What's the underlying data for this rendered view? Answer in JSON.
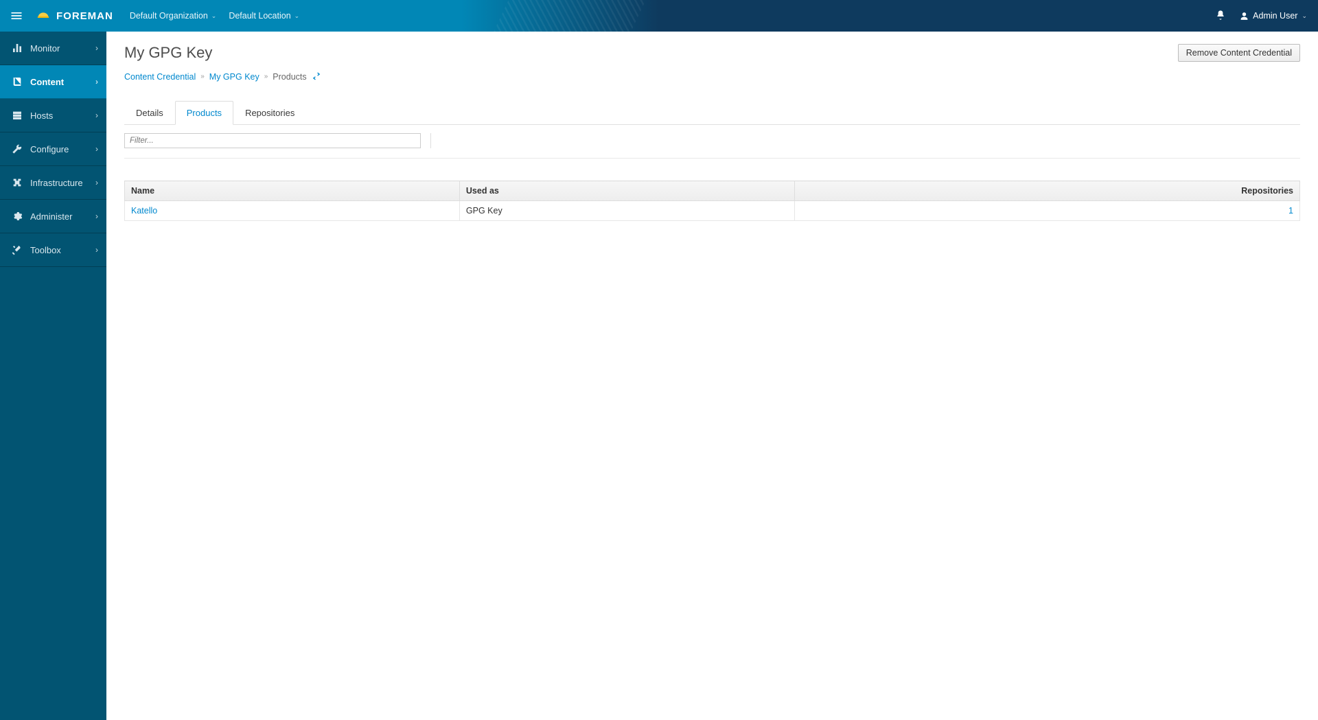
{
  "brand": "FOREMAN",
  "context": {
    "org": "Default Organization",
    "loc": "Default Location"
  },
  "user": "Admin User",
  "sidenav": [
    {
      "label": "Monitor",
      "icon": "dashboard"
    },
    {
      "label": "Content",
      "icon": "book",
      "active": true
    },
    {
      "label": "Hosts",
      "icon": "server"
    },
    {
      "label": "Configure",
      "icon": "wrench"
    },
    {
      "label": "Infrastructure",
      "icon": "network"
    },
    {
      "label": "Administer",
      "icon": "gear"
    },
    {
      "label": "Toolbox",
      "icon": "tools"
    }
  ],
  "page": {
    "title": "My GPG Key",
    "remove_btn": "Remove Content Credential"
  },
  "breadcrumb": {
    "root": "Content Credential",
    "mid": "My GPG Key",
    "leaf": "Products"
  },
  "tabs": [
    {
      "label": "Details"
    },
    {
      "label": "Products",
      "active": true
    },
    {
      "label": "Repositories"
    }
  ],
  "filter_placeholder": "Filter...",
  "table": {
    "headers": {
      "name": "Name",
      "used_as": "Used as",
      "repos": "Repositories"
    },
    "rows": [
      {
        "name": "Katello",
        "used_as": "GPG Key",
        "repos": "1"
      }
    ]
  }
}
